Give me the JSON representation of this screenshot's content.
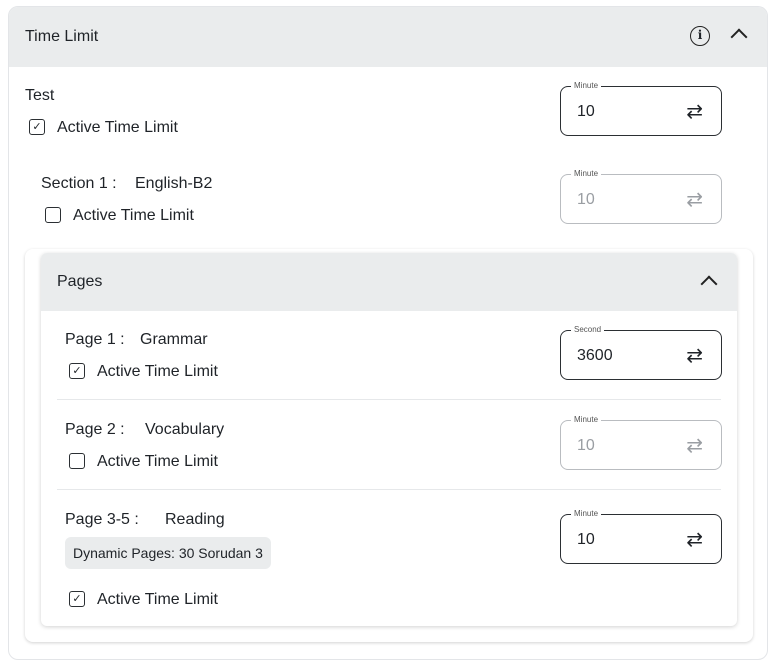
{
  "header": {
    "title": "Time Limit",
    "info_icon": "info-icon",
    "collapse_icon": "chevron-up-icon"
  },
  "test": {
    "label": "Test",
    "checkbox_label": "Active Time Limit",
    "checked": true,
    "field": {
      "label": "Minute",
      "value": "10"
    }
  },
  "section": {
    "label": "Section 1 :",
    "name": "English-B2",
    "checkbox_label": "Active Time Limit",
    "checked": false,
    "field": {
      "label": "Minute",
      "value": "10"
    }
  },
  "pages": {
    "title": "Pages",
    "items": [
      {
        "label": "Page 1 :",
        "name": "Grammar",
        "checkbox_label": "Active Time Limit",
        "checked": true,
        "field": {
          "label": "Second",
          "value": "3600"
        }
      },
      {
        "label": "Page 2 :",
        "name": "Vocabulary",
        "checkbox_label": "Active Time Limit",
        "checked": false,
        "field": {
          "label": "Minute",
          "value": "10"
        }
      },
      {
        "label": "Page 3-5 :",
        "name": "Reading",
        "chip": "Dynamic Pages: 30 Sorudan 3",
        "checkbox_label": "Active Time Limit",
        "checked": true,
        "field": {
          "label": "Minute",
          "value": "10"
        }
      }
    ]
  }
}
